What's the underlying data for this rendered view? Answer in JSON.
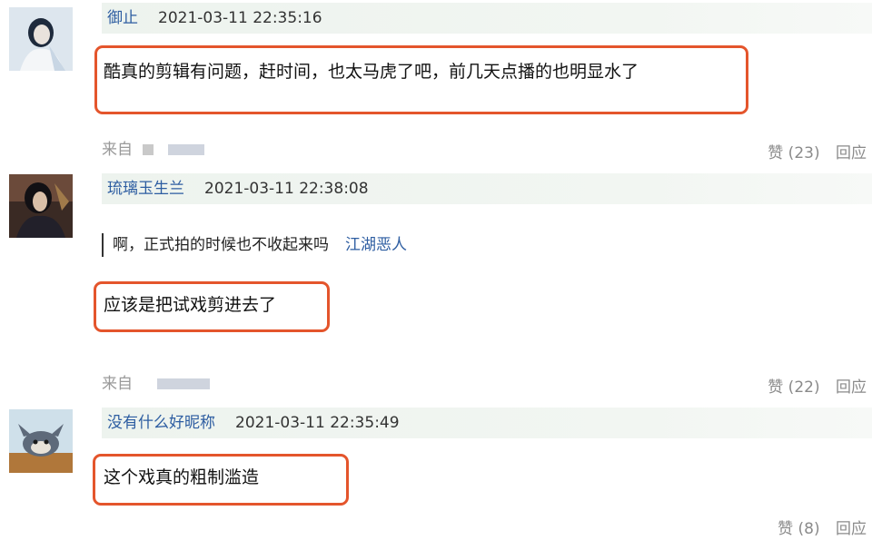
{
  "comments": [
    {
      "username": "御止",
      "time": "2021-03-11 22:35:16",
      "text": "酷真的剪辑有问题，赶时间，也太马虎了吧，前几天点播的也明显水了",
      "source": "来自",
      "likes": "赞 (23)",
      "reply": "回应"
    },
    {
      "username": "琉璃玉生兰",
      "time": "2021-03-11 22:38:08",
      "quote_text": "啊，正式拍的时候也不收起来吗",
      "quote_user": "江湖恶人",
      "text": "应该是把试戏剪进去了",
      "source": "来自",
      "likes": "赞 (22)",
      "reply": "回应"
    },
    {
      "username": "没有什么好昵称",
      "time": "2021-03-11 22:35:49",
      "text": "这个戏真的粗制滥造",
      "likes": "赞 (8)",
      "reply": "回应"
    }
  ],
  "colors": {
    "link_blue": "#2d5da1",
    "highlight_border": "#e4552c",
    "header_bg": "#edf3ee"
  }
}
